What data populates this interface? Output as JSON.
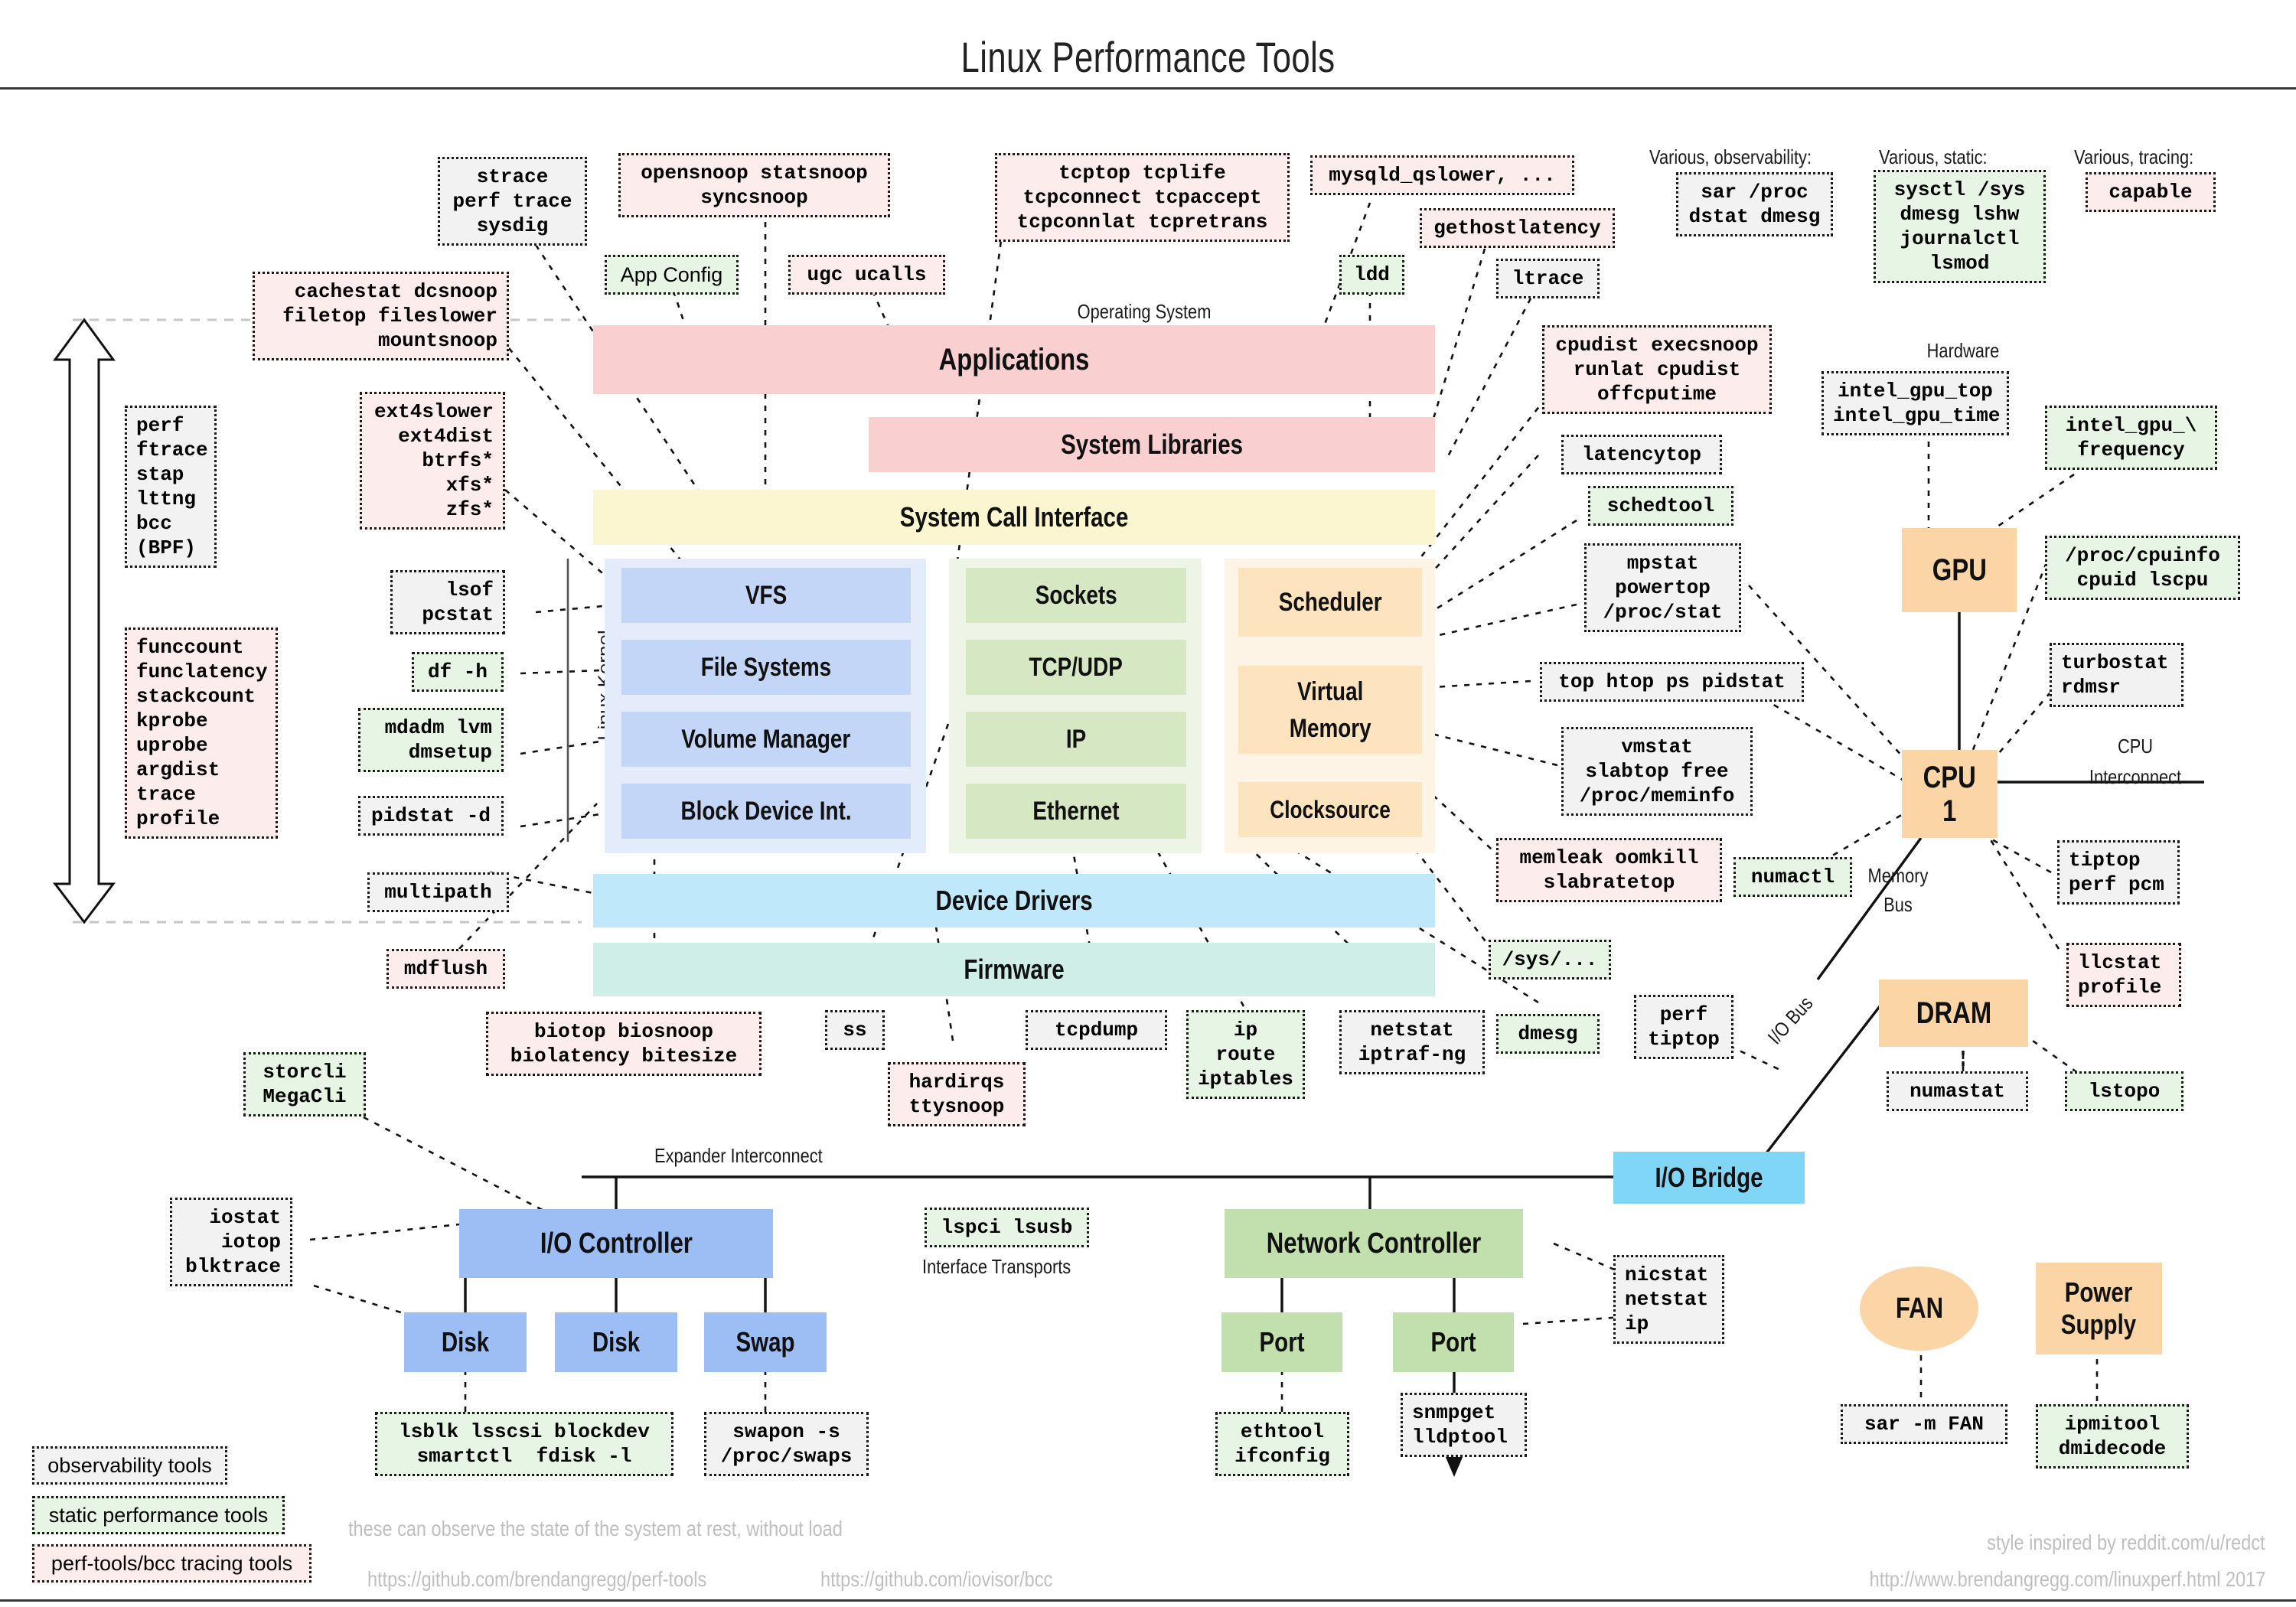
{
  "title": "Linux Performance Tools",
  "section_labels": {
    "operating_system": "Operating System",
    "hardware": "Hardware",
    "linux_kernel": "Linux Kernel",
    "various_observability": "Various, observability:",
    "various_static": "Various, static:",
    "various_tracing": "Various, tracing:",
    "cpu_interconnect": "CPU\nInterconnect",
    "memory_bus": "Memory\nBus",
    "io_bus": "I/O Bus",
    "expander_interconnect": "Expander Interconnect",
    "interface_transports": "Interface Transports"
  },
  "stack": {
    "applications": "Applications",
    "system_libraries": "System Libraries",
    "system_call_interface": "System Call Interface",
    "vfs": "VFS",
    "file_systems": "File Systems",
    "volume_manager": "Volume Manager",
    "block_device_int": "Block Device Int.",
    "sockets": "Sockets",
    "tcp_udp": "TCP/UDP",
    "ip": "IP",
    "ethernet": "Ethernet",
    "scheduler": "Scheduler",
    "virtual_memory": "Virtual\nMemory",
    "clocksource": "Clocksource",
    "device_drivers": "Device Drivers",
    "firmware": "Firmware"
  },
  "hardware": {
    "gpu": "GPU",
    "cpu": "CPU\n1",
    "dram": "DRAM",
    "io_bridge": "I/O Bridge",
    "io_controller": "I/O Controller",
    "disk1": "Disk",
    "disk2": "Disk",
    "swap": "Swap",
    "network_controller": "Network Controller",
    "port1": "Port",
    "port2": "Port",
    "fan": "FAN",
    "power_supply": "Power\nSupply"
  },
  "tools": {
    "strace": "strace\nperf trace\nsysdig",
    "opensnoop": "opensnoop statsnoop\nsyncsnoop",
    "app_config": "App Config",
    "ugc_ucalls": "ugc ucalls",
    "tcptop": "tcptop tcplife\ntcpconnect tcpaccept\ntcpconnlat tcpretrans",
    "mysqld_qslower": "mysqld_qslower, ...",
    "gethostlatency": "gethostlatency",
    "ldd": "ldd",
    "ltrace": "ltrace",
    "sar_proc": "sar /proc\ndstat dmesg",
    "sysctl": "sysctl /sys\ndmesg lshw\njournalctl\nlsmod",
    "capable": "capable",
    "cachestat": "cachestat dcsnoop\nfiletop fileslower\nmountsnoop",
    "perf_ftrace": "perf\nftrace\nstap\nlttng\nbcc\n(BPF)",
    "funccount": "funccount\nfunclatency\nstackcount\nkprobe\nuprobe\nargdist\ntrace\nprofile",
    "ext4slower": "ext4slower\next4dist\nbtrfs*\nxfs*\nzfs*",
    "lsof_pcstat": "lsof\npcstat",
    "df_h": "df -h",
    "mdadm_lvm": "mdadm lvm\ndmsetup",
    "pidstat_d": "pidstat -d",
    "multipath": "multipath",
    "mdflush": "mdflush",
    "cpudist": "cpudist execsnoop\nrunlat cpudist\noffcputime",
    "latencytop": "latencytop",
    "schedtool": "schedtool",
    "mpstat": "mpstat\npowertop\n/proc/stat",
    "top_htop": "top htop ps pidstat",
    "vmstat": "vmstat\nslabtop free\n/proc/meminfo",
    "memleak": "memleak oomkill\nslabratetop",
    "numactl": "numactl",
    "sys_dots": "/sys/...",
    "intel_gpu_top": "intel_gpu_top\nintel_gpu_time",
    "intel_gpu_frequency": "intel_gpu_\\\nfrequency",
    "proc_cpuinfo": "/proc/cpuinfo\ncpuid lscpu",
    "turbostat": "turbostat\nrdmsr",
    "tiptop_perf_pcm": "tiptop\nperf pcm",
    "llcstat": "llcstat\nprofile",
    "lstopo": "lstopo",
    "numastat": "numastat",
    "perf_tiptop": "perf\ntiptop",
    "dmesg": "dmesg",
    "netstat_iptraf": "netstat\niptraf-ng",
    "ip_route": "ip\nroute\niptables",
    "tcpdump": "tcpdump",
    "ss": "ss",
    "hardirqs": "hardirqs\nttysnoop",
    "biotop": "biotop biosnoop\nbiolatency bitesize",
    "storcli": "storcli\nMegaCli",
    "iostat": "iostat\niotop\nblktrace",
    "lsblk": "lsblk lsscsi blockdev\nsmartctl  fdisk -l",
    "swapon": "swapon -s\n/proc/swaps",
    "lspci": "lspci lsusb",
    "nicstat": "nicstat\nnetstat\nip",
    "ethtool": "ethtool\nifconfig",
    "snmpget": "snmpget\nlldptool",
    "sar_fan": "sar -m FAN",
    "ipmitool": "ipmitool\ndmidecode"
  },
  "legend": {
    "observability": "observability tools",
    "static": "static performance tools",
    "tracing": "perf-tools/bcc tracing tools",
    "note_static": "these can observe the state of the system at rest, without load",
    "url_perf_tools": "https://github.com/brendangregg/perf-tools",
    "url_bcc": "https://github.com/iovisor/bcc",
    "credit_style": "style inspired by reddit.com/u/redct",
    "credit_url": "http://www.brendangregg.com/linuxperf.html 2017"
  },
  "colors": {
    "observability_bg": "#f2f2f2",
    "static_bg": "#e7f5e4",
    "tracing_bg": "#fcecec",
    "applications": "#f9cfcf",
    "syscall": "#fbf6cf",
    "kernel_blue": "#c4d6f7",
    "kernel_green": "#d6e7c3",
    "kernel_orange": "#fde4bf",
    "drivers": "#bfe9fb",
    "firmware": "#cfeee7",
    "hardware_orange": "#fbd5a5",
    "io_bridge": "#7fd6f7"
  }
}
